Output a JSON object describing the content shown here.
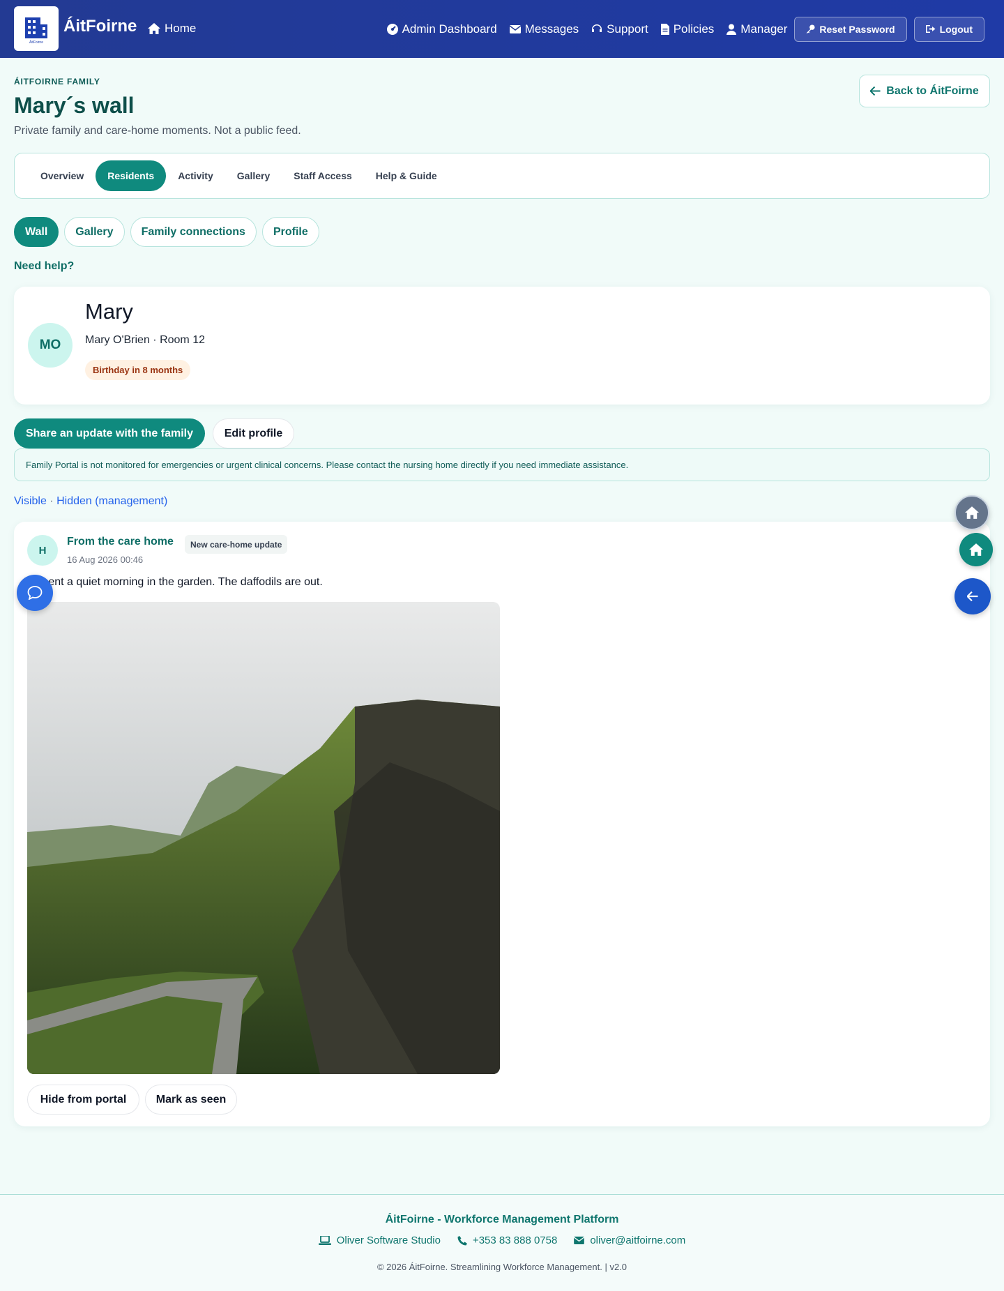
{
  "app": {
    "brand": "ÁitFoirne",
    "logo_caption": "ÁitFoirne"
  },
  "topnav": {
    "home": "Home",
    "admin_dashboard": "Admin Dashboard",
    "messages": "Messages",
    "support": "Support",
    "policies": "Policies",
    "manager": "Manager",
    "reset_password": "Reset Password",
    "logout": "Logout"
  },
  "header": {
    "eyebrow": "ÁITFOIRNE FAMILY",
    "title": "Mary´s wall",
    "subtitle": "Private family and care-home moments. Not a public feed.",
    "back_label": "Back to ÁitFoirne"
  },
  "main_tabs": [
    {
      "label": "Overview",
      "active": false
    },
    {
      "label": "Residents",
      "active": true
    },
    {
      "label": "Activity",
      "active": false
    },
    {
      "label": "Gallery",
      "active": false
    },
    {
      "label": "Staff Access",
      "active": false
    },
    {
      "label": "Help & Guide",
      "active": false
    }
  ],
  "sub_tabs": [
    {
      "label": "Wall",
      "active": true
    },
    {
      "label": "Gallery",
      "active": false
    },
    {
      "label": "Family connections",
      "active": false
    },
    {
      "label": "Profile",
      "active": false
    }
  ],
  "need_help": "Need help?",
  "profile": {
    "initials": "MO",
    "name": "Mary",
    "meta": "Mary O'Brien · Room 12",
    "birthday_badge": "Birthday in 8 months"
  },
  "actions": {
    "share": "Share an update with the family",
    "edit_profile": "Edit profile"
  },
  "notice": "Family Portal is not monitored for emergencies or urgent clinical concerns. Please contact the nursing home directly if you need immediate assistance.",
  "visibility": {
    "visible": "Visible",
    "separator": "·",
    "hidden": "Hidden (management)"
  },
  "post": {
    "avatar_initial": "H",
    "author": "From the care home",
    "tag": "New care-home update",
    "timestamp": "16 Aug 2026 00:46",
    "text": "y spent a quiet morning in the garden. The daffodils are out.",
    "hide_label": "Hide from portal",
    "seen_label": "Mark as seen"
  },
  "footer": {
    "title": "ÁitFoirne - Workforce Management Platform",
    "studio": "Oliver Software Studio",
    "phone": "+353 83 888 0758",
    "email": "oliver@aitfoirne.com",
    "copyright": "© 2026 ÁitFoirne. Streamlining Workforce Management. | v2.0"
  },
  "colors": {
    "nav_bg": "#233a93",
    "accent": "#0f8a7e",
    "page_bg": "#f1fbf9",
    "link_blue": "#2563eb"
  }
}
